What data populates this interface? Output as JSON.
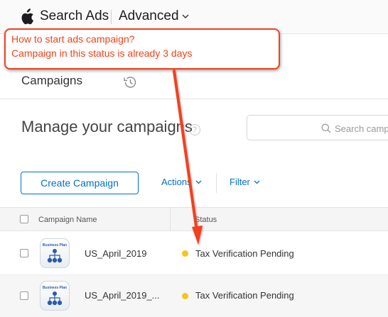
{
  "header": {
    "brand": "Search Ads",
    "mode": "Advanced"
  },
  "nav": {
    "tab_campaigns": "Campaigns"
  },
  "main": {
    "title": "Manage your campaigns",
    "help": "?",
    "search_placeholder": "Search campaigns",
    "create_button": "Create Campaign",
    "actions_label": "Actions",
    "filter_label": "Filter"
  },
  "table": {
    "columns": [
      "Campaign Name",
      "Status"
    ],
    "rows": [
      {
        "name": "US_April_2019",
        "status": "Tax Verification Pending",
        "status_color": "#f5c518",
        "app_icon_label": "Business Plan"
      },
      {
        "name": "US_April_2019_...",
        "status": "Tax Verification Pending",
        "status_color": "#f5c518",
        "app_icon_label": "Business Plan"
      }
    ]
  },
  "annotation": {
    "line1": "How to start ads campaign?",
    "line2": "Campaign in this status is already 3 days",
    "color": "#f4411a"
  },
  "colors": {
    "accent": "#0070c9",
    "status_pending": "#f5c518"
  }
}
